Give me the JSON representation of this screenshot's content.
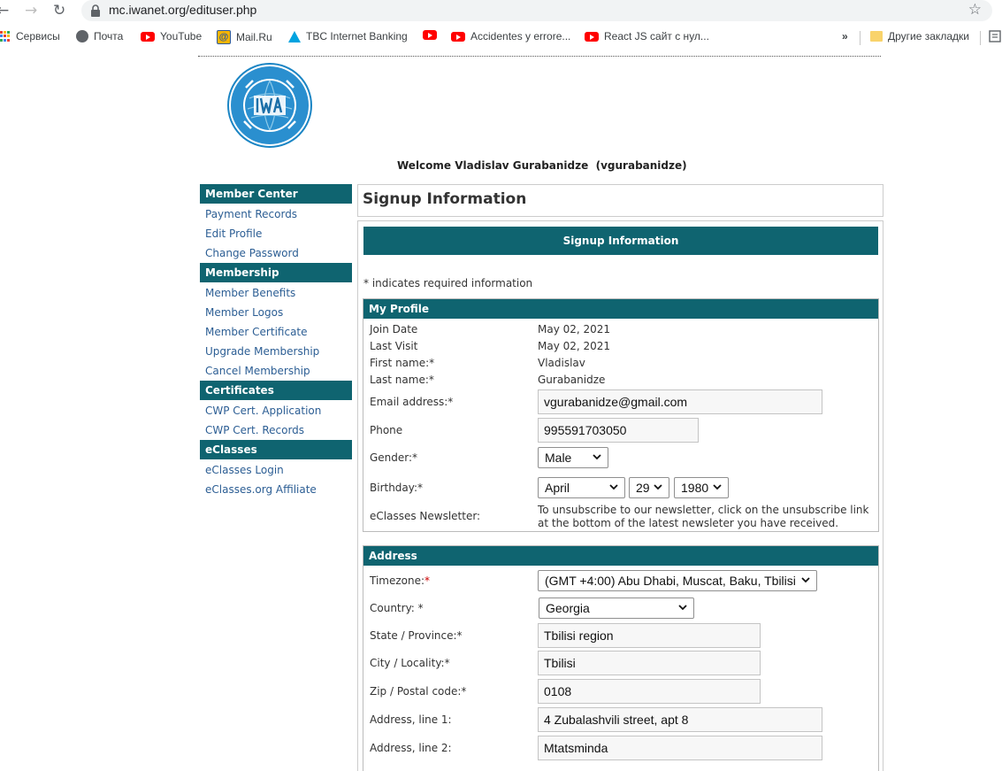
{
  "browser": {
    "url": "mc.iwanet.org/edituser.php",
    "bookmarks": [
      {
        "label": "Сервисы",
        "icon": "apps-grid-icon"
      },
      {
        "label": "Почта",
        "icon": "globe-icon"
      },
      {
        "label": "YouTube",
        "icon": "youtube-icon"
      },
      {
        "label": "Mail.Ru",
        "icon": "mailru-icon"
      },
      {
        "label": "TBC Internet Banking",
        "icon": "tbc-icon"
      },
      {
        "label": "",
        "icon": "youtube-icon"
      },
      {
        "label": "Accidentes y errore...",
        "icon": "youtube-icon"
      },
      {
        "label": "React JS сайт с нул...",
        "icon": "youtube-icon"
      }
    ],
    "overflow_label": "»",
    "other_bookmarks": "Другие закладки"
  },
  "header": {
    "welcome": "Welcome Vladislav Gurabanidze  (vgurabanidze)"
  },
  "sidebar": {
    "sections": [
      {
        "title": "Member Center",
        "links": [
          "Payment Records",
          "Edit Profile",
          "Change Password"
        ]
      },
      {
        "title": "Membership",
        "links": [
          "Member Benefits",
          "Member Logos",
          "Member Certificate",
          "Upgrade Membership",
          "Cancel Membership"
        ]
      },
      {
        "title": "Certificates",
        "links": [
          "CWP Cert. Application",
          "CWP Cert. Records"
        ]
      },
      {
        "title": "eClasses",
        "links": [
          "eClasses Login",
          "eClasses.org Affiliate"
        ]
      }
    ]
  },
  "main": {
    "title": "Signup Information",
    "banner": "Signup Information",
    "required_note": "* indicates required information",
    "profile": {
      "title": "My Profile",
      "join_date_label": "Join Date",
      "join_date": "May 02, 2021",
      "last_visit_label": "Last Visit",
      "last_visit": "May 02, 2021",
      "first_name_label": "First name:*",
      "first_name": "Vladislav",
      "last_name_label": "Last name:*",
      "last_name": "Gurabanidze",
      "email_label": "Email address:*",
      "email": "vgurabanidze@gmail.com",
      "phone_label": "Phone",
      "phone": "995591703050",
      "gender_label": "Gender:*",
      "gender": "Male",
      "birthday_label": "Birthday:*",
      "birth_month": "April",
      "birth_day": "29",
      "birth_year": "1980",
      "newsletter_label": "eClasses Newsletter:",
      "newsletter_text": "To unsubscribe to our newsletter, click on the unsubscribe link at the bottom of the latest newsleter you have received."
    },
    "address": {
      "title": "Address",
      "timezone_label": "Timezone:",
      "timezone_star": "*",
      "timezone": "(GMT +4:00) Abu Dhabi, Muscat, Baku, Tbilisi",
      "country_label": "Country: *",
      "country": "Georgia",
      "state_label": "State / Province:*",
      "state": "Tbilisi region",
      "city_label": "City / Locality:*",
      "city": "Tbilisi",
      "zip_label": "Zip / Postal code:*",
      "zip": "0108",
      "address1_label": "Address, line 1:",
      "address1": "4 Zubalashvili street, apt 8",
      "address2_label": "Address, line 2:",
      "address2": "Mtatsminda"
    }
  },
  "colors": {
    "header_teal": "#0f6470",
    "link_blue": "#2c5e94",
    "required_red": "#cc0000"
  }
}
